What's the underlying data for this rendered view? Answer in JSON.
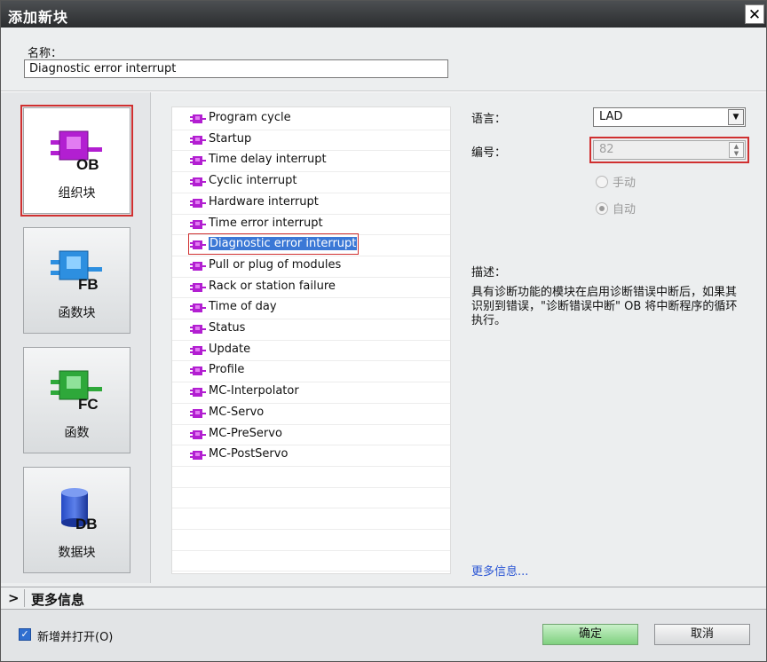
{
  "window": {
    "title": "添加新块",
    "close_glyph": "✕"
  },
  "name": {
    "label": "名称：",
    "value": "Diagnostic error interrupt"
  },
  "block_types": [
    {
      "tag": "OB",
      "label": "组织块",
      "color": "#b21fd1",
      "selected": true
    },
    {
      "tag": "FB",
      "label": "函数块",
      "color": "#2d8fe0",
      "selected": false
    },
    {
      "tag": "FC",
      "label": "函数",
      "color": "#2ea83a",
      "selected": false
    },
    {
      "tag": "DB",
      "label": "数据块",
      "color": "#2449c4",
      "selected": false
    }
  ],
  "ob_list": [
    "Program cycle",
    "Startup",
    "Time delay interrupt",
    "Cyclic interrupt",
    "Hardware interrupt",
    "Time error interrupt",
    "Diagnostic error interrupt",
    "Pull or plug of modules",
    "Rack or station failure",
    "Time of day",
    "Status",
    "Update",
    "Profile",
    "MC-Interpolator",
    "MC-Servo",
    "MC-PreServo",
    "MC-PostServo"
  ],
  "selected_item": "Diagnostic error interrupt",
  "properties": {
    "language_label": "语言：",
    "language_value": "LAD",
    "number_label": "编号：",
    "number_value": "82",
    "radio_manual": "手动",
    "radio_auto": "自动",
    "description_label": "描述：",
    "description_text": "具有诊断功能的模块在启用诊断错误中断后，如果其识别到错误，\"诊断错误中断\" OB 将中断程序的循环执行。",
    "more_info_link": "更多信息..."
  },
  "more_info_bar": {
    "chevron": ">",
    "label": "更多信息"
  },
  "footer": {
    "checkbox_label": "新增并打开(O)",
    "checkbox_checked": true,
    "ok_label": "确定",
    "cancel_label": "取消"
  },
  "icons": {
    "ob_item_icon": "purple-block-icon",
    "block_colors": {
      "OB": "#b21fd1",
      "FB": "#2d8fe0",
      "FC": "#2ea83a",
      "DB": "#2449c4"
    }
  }
}
